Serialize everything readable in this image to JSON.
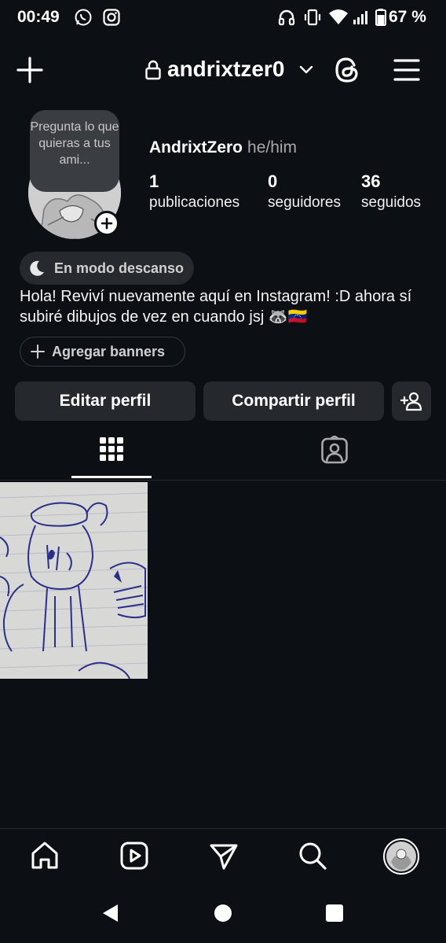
{
  "status_bar": {
    "time": "00:49",
    "battery": "67 %",
    "icons": [
      "whatsapp-icon",
      "instagram-icon",
      "headphones-icon",
      "vibrate-icon",
      "wifi-icon",
      "signal-icon",
      "battery-icon"
    ]
  },
  "header": {
    "username": "andrixtzer0",
    "icons": [
      "plus-icon",
      "lock-icon",
      "chevron-down-icon",
      "threads-icon",
      "menu-icon"
    ]
  },
  "profile": {
    "note": "Pregunta lo que quieras a tus ami...",
    "display_name": "AndrixtZero",
    "pronouns": "he/him",
    "stats": [
      {
        "value": "1",
        "label": "publicaciones"
      },
      {
        "value": "0",
        "label": "seguidores"
      },
      {
        "value": "36",
        "label": "seguidos"
      }
    ],
    "status_chip": "En modo descanso",
    "bio": "Hola! Reviví nuevamente aquí en Instagram! :D ahora sí subiré dibujos de vez en cuando jsj 🦝🇻🇪",
    "banners_label": "Agregar banners"
  },
  "actions": {
    "edit": "Editar perfil",
    "share": "Compartir perfil"
  },
  "tabs": [
    "grid-icon",
    "tagged-icon"
  ],
  "bottom_nav": [
    "home-icon",
    "reels-icon",
    "direct-icon",
    "search-icon",
    "profile-avatar"
  ],
  "colors": {
    "background": "#0c1014",
    "button": "#25292e",
    "text": "#f5f5f5",
    "muted": "#a8a8a8"
  }
}
